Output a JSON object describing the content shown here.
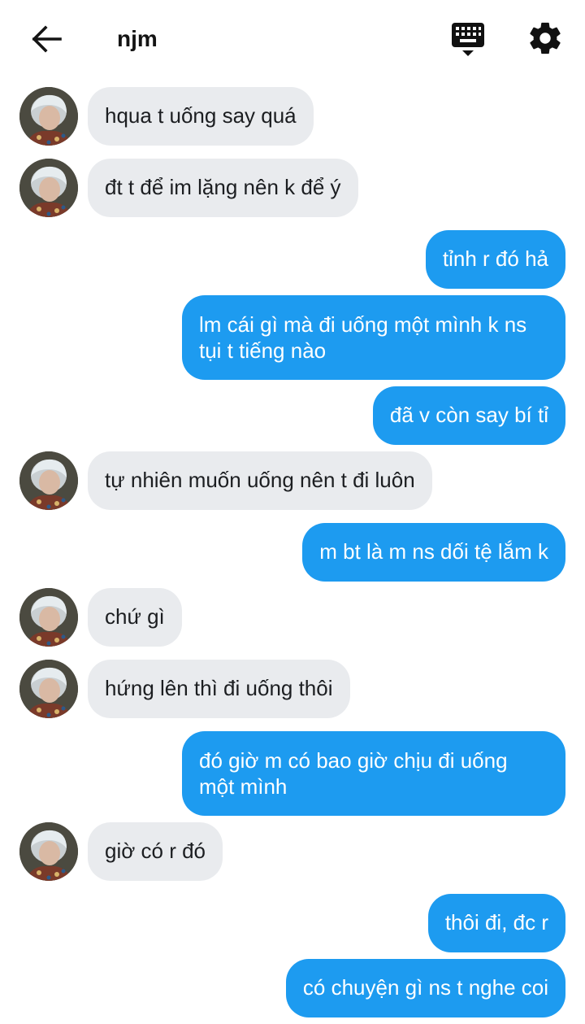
{
  "header": {
    "title": "njm",
    "back_icon": "arrow-left-icon",
    "keyboard_icon": "keyboard-hide-icon",
    "settings_icon": "gear-icon"
  },
  "colors": {
    "incoming_bubble": "#e9ebee",
    "outgoing_bubble": "#1d9bf0",
    "outgoing_text": "#ffffff",
    "incoming_text": "#1c1e21"
  },
  "messages": [
    {
      "side": "in",
      "text": "hqua t uống say quá"
    },
    {
      "side": "in",
      "text": "đt t để im lặng nên k để ý"
    },
    {
      "side": "out",
      "text": "tỉnh r đó hả"
    },
    {
      "side": "out",
      "text": "lm cái gì mà đi uống một mình k ns tụi t tiếng nào"
    },
    {
      "side": "out",
      "text": "đã v còn say bí tỉ"
    },
    {
      "side": "in",
      "text": "tự nhiên muốn uống nên t đi luôn"
    },
    {
      "side": "out",
      "text": "m bt là m ns dối tệ lắm k"
    },
    {
      "side": "in",
      "text": "chứ gì"
    },
    {
      "side": "in",
      "text": "hứng lên thì đi uống thôi"
    },
    {
      "side": "out",
      "text": "đó giờ m có bao giờ chịu đi uống một mình"
    },
    {
      "side": "in",
      "text": "giờ có r đó"
    },
    {
      "side": "out",
      "text": "thôi đi, đc r"
    },
    {
      "side": "out",
      "text": "có chuyện gì ns t nghe coi"
    }
  ]
}
